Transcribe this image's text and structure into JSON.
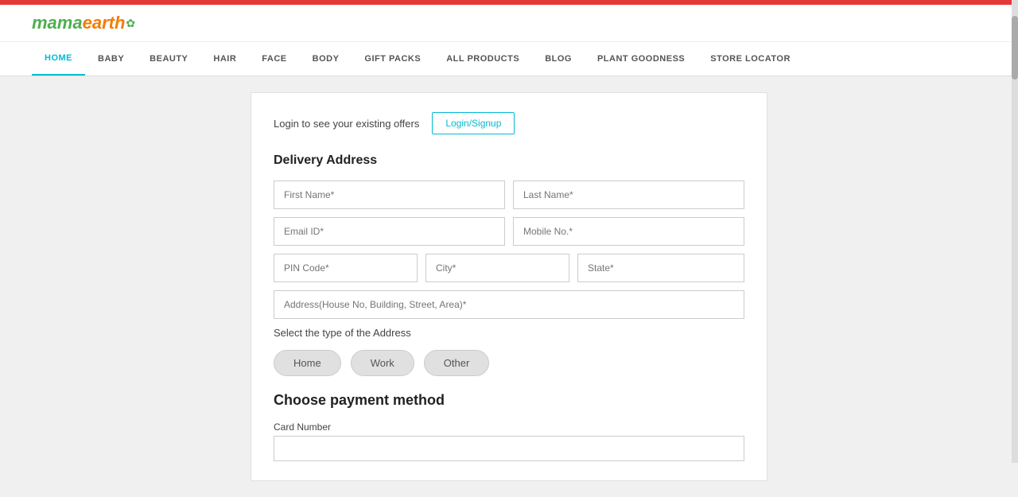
{
  "topbar": {},
  "header": {
    "logo_mama": "mama",
    "logo_earth": "earth",
    "logo_leaf": "✿"
  },
  "nav": {
    "items": [
      {
        "label": "HOME",
        "active": true
      },
      {
        "label": "BABY",
        "active": false
      },
      {
        "label": "BEAUTY",
        "active": false
      },
      {
        "label": "HAIR",
        "active": false
      },
      {
        "label": "FACE",
        "active": false
      },
      {
        "label": "BODY",
        "active": false
      },
      {
        "label": "GIFT PACKS",
        "active": false
      },
      {
        "label": "ALL PRODUCTS",
        "active": false
      },
      {
        "label": "BLOG",
        "active": false
      },
      {
        "label": "PLANT GOODNESS",
        "active": false
      },
      {
        "label": "STORE LOCATOR",
        "active": false
      }
    ]
  },
  "login_bar": {
    "text": "Login to see your existing offers",
    "button_label": "Login/Signup"
  },
  "delivery_section": {
    "title": "Delivery Address",
    "fields": {
      "first_name_placeholder": "First Name*",
      "last_name_placeholder": "Last Name*",
      "email_placeholder": "Email ID*",
      "mobile_placeholder": "Mobile No.*",
      "pin_placeholder": "PIN Code*",
      "city_placeholder": "City*",
      "state_placeholder": "State*",
      "address_placeholder": "Address(House No, Building, Street, Area)*"
    },
    "address_type_label": "Select the type of the Address",
    "address_type_buttons": [
      {
        "label": "Home"
      },
      {
        "label": "Work"
      },
      {
        "label": "Other"
      }
    ]
  },
  "payment_section": {
    "title": "Choose payment method",
    "card_number_label": "Card Number"
  }
}
